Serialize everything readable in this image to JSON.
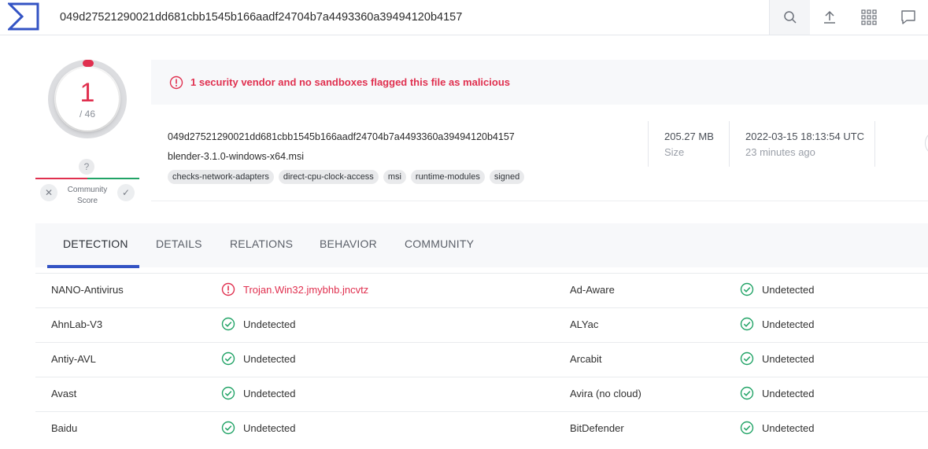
{
  "search": {
    "value": "049d27521290021dd681cbb1545b166aadf24704b7a4493360a39494120b4157"
  },
  "score": {
    "detections": "1",
    "total": "/ 46",
    "community_label_1": "Community",
    "community_label_2": "Score",
    "unknown": "?"
  },
  "alert": {
    "text": "1 security vendor and no sandboxes flagged this file as malicious"
  },
  "file": {
    "hash": "049d27521290021dd681cbb1545b166aadf24704b7a4493360a39494120b4157",
    "name": "blender-3.1.0-windows-x64.msi",
    "tags": [
      "checks-network-adapters",
      "direct-cpu-clock-access",
      "msi",
      "runtime-modules",
      "signed"
    ],
    "size_value": "205.27 MB",
    "size_label": "Size",
    "date_value": "2022-03-15 18:13:54 UTC",
    "date_label": "23 minutes ago"
  },
  "tabs": [
    "DETECTION",
    "DETAILS",
    "RELATIONS",
    "BEHAVIOR",
    "COMMUNITY"
  ],
  "detections": [
    {
      "left_vendor": "NANO-Antivirus",
      "left_result": "Trojan.Win32.jmybhb.jncvtz",
      "left_malicious": true,
      "right_vendor": "Ad-Aware",
      "right_result": "Undetected"
    },
    {
      "left_vendor": "AhnLab-V3",
      "left_result": "Undetected",
      "left_malicious": false,
      "right_vendor": "ALYac",
      "right_result": "Undetected"
    },
    {
      "left_vendor": "Antiy-AVL",
      "left_result": "Undetected",
      "left_malicious": false,
      "right_vendor": "Arcabit",
      "right_result": "Undetected"
    },
    {
      "left_vendor": "Avast",
      "left_result": "Undetected",
      "left_malicious": false,
      "right_vendor": "Avira (no cloud)",
      "right_result": "Undetected"
    },
    {
      "left_vendor": "Baidu",
      "left_result": "Undetected",
      "left_malicious": false,
      "right_vendor": "BitDefender",
      "right_result": "Undetected"
    }
  ],
  "colors": {
    "malicious": "#e0304f",
    "clean": "#21a366",
    "accent": "#3353c4"
  },
  "icons": {
    "logo": "virustotal-logo",
    "search": "search-icon",
    "upload": "upload-icon",
    "apps": "apps-grid-icon",
    "chat": "chat-icon"
  }
}
